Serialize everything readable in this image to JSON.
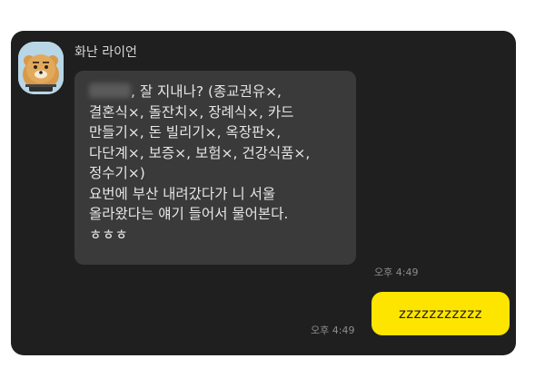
{
  "chat": {
    "sender_name": "화난 라이언",
    "incoming_message": "잘 지내나? (종교권유×,\n결혼식×, 돌잔치×, 장례식×, 카드\n만들기×, 돈 빌리기×, 옥장판×,\n다단계×, 보증×, 보험×, 건강식품×,\n정수기×)\n요번에 부산 내려갔다가 니 서울\n올라왔다는 얘기 들어서 물어본다.\nㅎㅎㅎ",
    "incoming_time": "오후 4:49",
    "outgoing_message": "zzzzzzzzzzz",
    "outgoing_time": "오후 4:49"
  },
  "colors": {
    "chat_background": "#1f1f1f",
    "incoming_bubble": "#3a3a3a",
    "outgoing_bubble": "#fee500"
  },
  "icons": {
    "avatar": "ryan-character-avatar"
  }
}
